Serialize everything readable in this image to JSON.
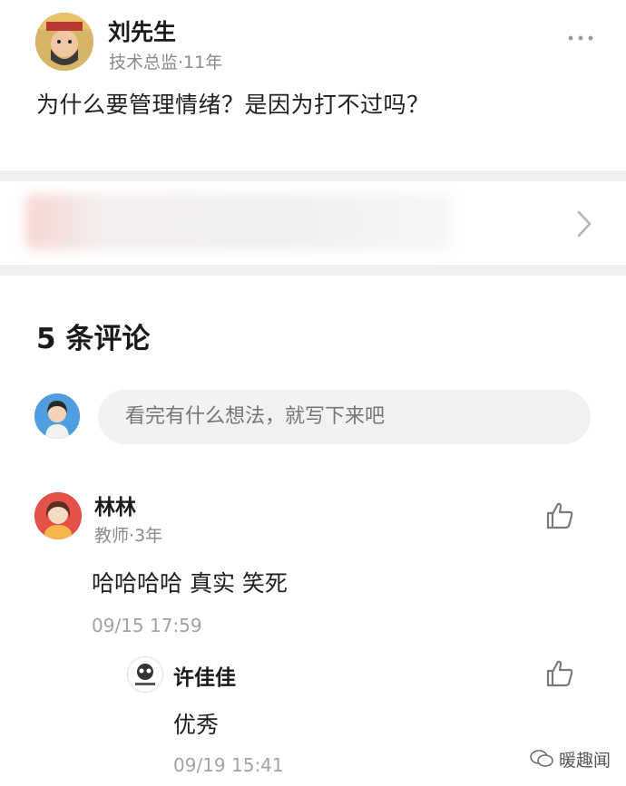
{
  "post": {
    "author_name": "刘先生",
    "author_meta": "技术总监·11年",
    "text": "为什么要管理情绪？是因为打不过吗？"
  },
  "comments_section": {
    "title": "5 条评论",
    "compose_placeholder": "看完有什么想法，就写下来吧"
  },
  "comments": [
    {
      "name": "林林",
      "meta": "教师·3年",
      "text": "哈哈哈哈 真实 笑死",
      "time": "09/15 17:59",
      "replies": [
        {
          "name": "许佳佳",
          "text": "优秀",
          "time": "09/19 15:41"
        }
      ]
    }
  ],
  "watermark": {
    "text": "暖趣闻",
    "icon": "wechat-icon"
  },
  "icons": {
    "more": "more-icon",
    "chevron": "chevron-right-icon",
    "like": "thumbs-up-icon"
  },
  "colors": {
    "separator": "#f0f0f0",
    "input_bg": "#f2f2f2",
    "meta_text": "#8a8a8a"
  }
}
